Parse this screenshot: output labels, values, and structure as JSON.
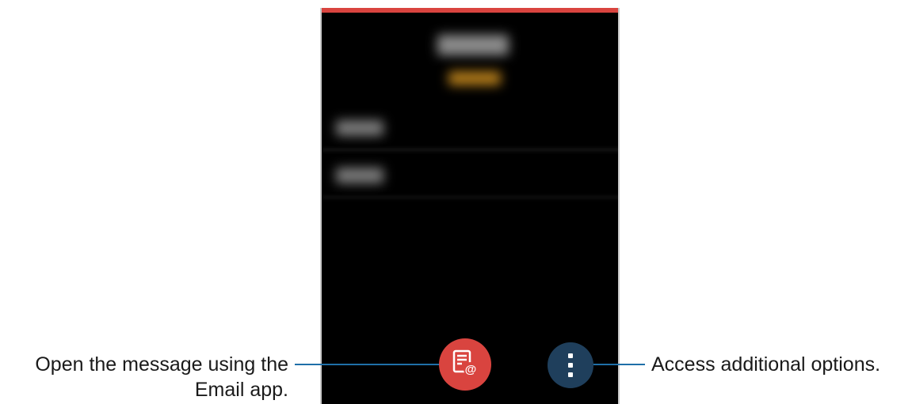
{
  "callouts": {
    "open_email_line1": "Open the message using the",
    "open_email_line2": "Email app.",
    "more_options": "Access additional options."
  },
  "icons": {
    "email_button": "email-app-icon",
    "more_button": "more-options-icon"
  },
  "colors": {
    "accent_red": "#d9443f",
    "more_button_blue": "#1f3f5c",
    "leader_line": "#1f6fa8",
    "screen_background": "#000000"
  }
}
